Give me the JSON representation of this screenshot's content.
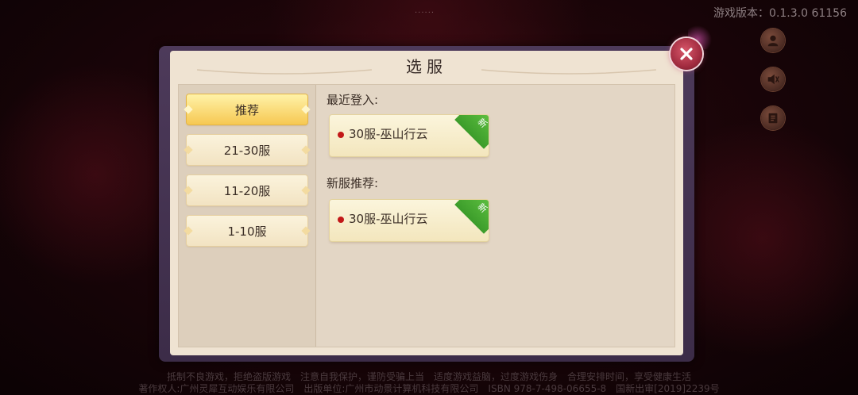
{
  "top_indicator": "......",
  "version": "游戏版本：0.1.3.0 61156",
  "dialog": {
    "title": "选服",
    "tabs": [
      {
        "label": "推荐",
        "active": true
      },
      {
        "label": "21-30服",
        "active": false
      },
      {
        "label": "11-20服",
        "active": false
      },
      {
        "label": "1-10服",
        "active": false
      }
    ],
    "recent_label": "最近登入:",
    "recent_server": {
      "name": "30服-巫山行云",
      "badge": "新",
      "status_color": "#c21818"
    },
    "new_label": "新服推荐:",
    "new_server": {
      "name": "30服-巫山行云",
      "badge": "新",
      "status_color": "#c21818"
    }
  },
  "side_buttons": [
    {
      "icon": "user-icon"
    },
    {
      "icon": "sound-icon"
    },
    {
      "icon": "notice-book-icon"
    }
  ],
  "footer": {
    "line1": "抵制不良游戏，拒绝盗版游戏　注意自我保护，谨防受骗上当　适度游戏益脑，过度游戏伤身　合理安排时间，享受健康生活",
    "line2": "著作权人:广州灵犀互动娱乐有限公司　出版单位:广州市动景计算机科技有限公司　ISBN 978-7-498-06655-8　国新出审[2019]2239号"
  },
  "colors": {
    "panel_bg": "#efe3d2",
    "active_tab": "#f6c852",
    "new_badge": "#3b9c2a",
    "close_button": "#a22c40"
  }
}
